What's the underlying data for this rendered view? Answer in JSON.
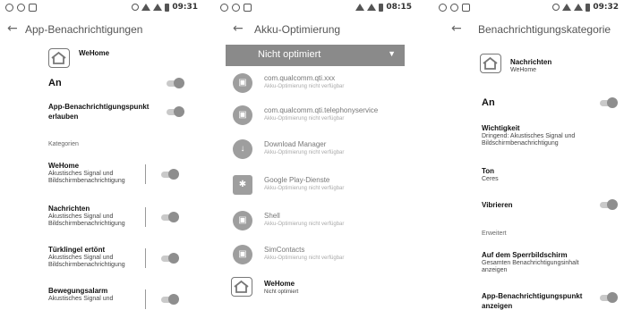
{
  "panel1": {
    "status_time": "09:31",
    "title": "App-Benachrichtigungen",
    "app_name": "WeHome",
    "main_toggle_label": "An",
    "dot_setting_label": "App-Benachrichtigungspunkt erlauben",
    "section_label": "Kategorien",
    "categories": [
      {
        "title": "WeHome",
        "subtitle": "Akustisches Signal und Bildschirmbenachrichtigung"
      },
      {
        "title": "Nachrichten",
        "subtitle": "Akustisches Signal und Bildschirmbenachrichtigung"
      },
      {
        "title": "Türklingel ertönt",
        "subtitle": "Akustisches Signal und Bildschirmbenachrichtigung"
      },
      {
        "title": "Bewegungsalarm",
        "subtitle": "Akustisches Signal und"
      }
    ]
  },
  "panel2": {
    "status_time": "08:15",
    "title": "Akku-Optimierung",
    "filter_value": "Nicht optimiert",
    "apps": [
      {
        "name": "com.qualcomm.qti.xxx",
        "status": "Akku-Optimierung nicht verfügbar"
      },
      {
        "name": "com.qualcomm.qti.telephonyservice",
        "status": "Akku-Optimierung nicht verfügbar"
      },
      {
        "name": "Download Manager",
        "status": "Akku-Optimierung nicht verfügbar"
      },
      {
        "name": "Google Play-Dienste",
        "status": "Akku-Optimierung nicht verfügbar"
      },
      {
        "name": "Shell",
        "status": "Akku-Optimierung nicht verfügbar"
      },
      {
        "name": "SimContacts",
        "status": "Akku-Optimierung nicht verfügbar"
      }
    ],
    "last_app": {
      "name": "WeHome",
      "status": "Nicht optimiert"
    }
  },
  "panel3": {
    "status_time": "09:32",
    "title": "Benachrichtigungskategorie",
    "channel_name": "Nachrichten",
    "channel_app": "WeHome",
    "main_toggle_label": "An",
    "importance_title": "Wichtigkeit",
    "importance_value": "Dringend: Akustisches Signal und Bildschirmbenachrichtigung",
    "sound_title": "Ton",
    "sound_value": "Ceres",
    "vibrate_label": "Vibrieren",
    "advanced_label": "Erweitert",
    "lockscreen_title": "Auf dem Sperrbildschirm",
    "lockscreen_value": "Gesamten Benachrichtigungsinhalt anzeigen",
    "dot_title": "App-Benachrichtigungspunkt anzeigen"
  }
}
